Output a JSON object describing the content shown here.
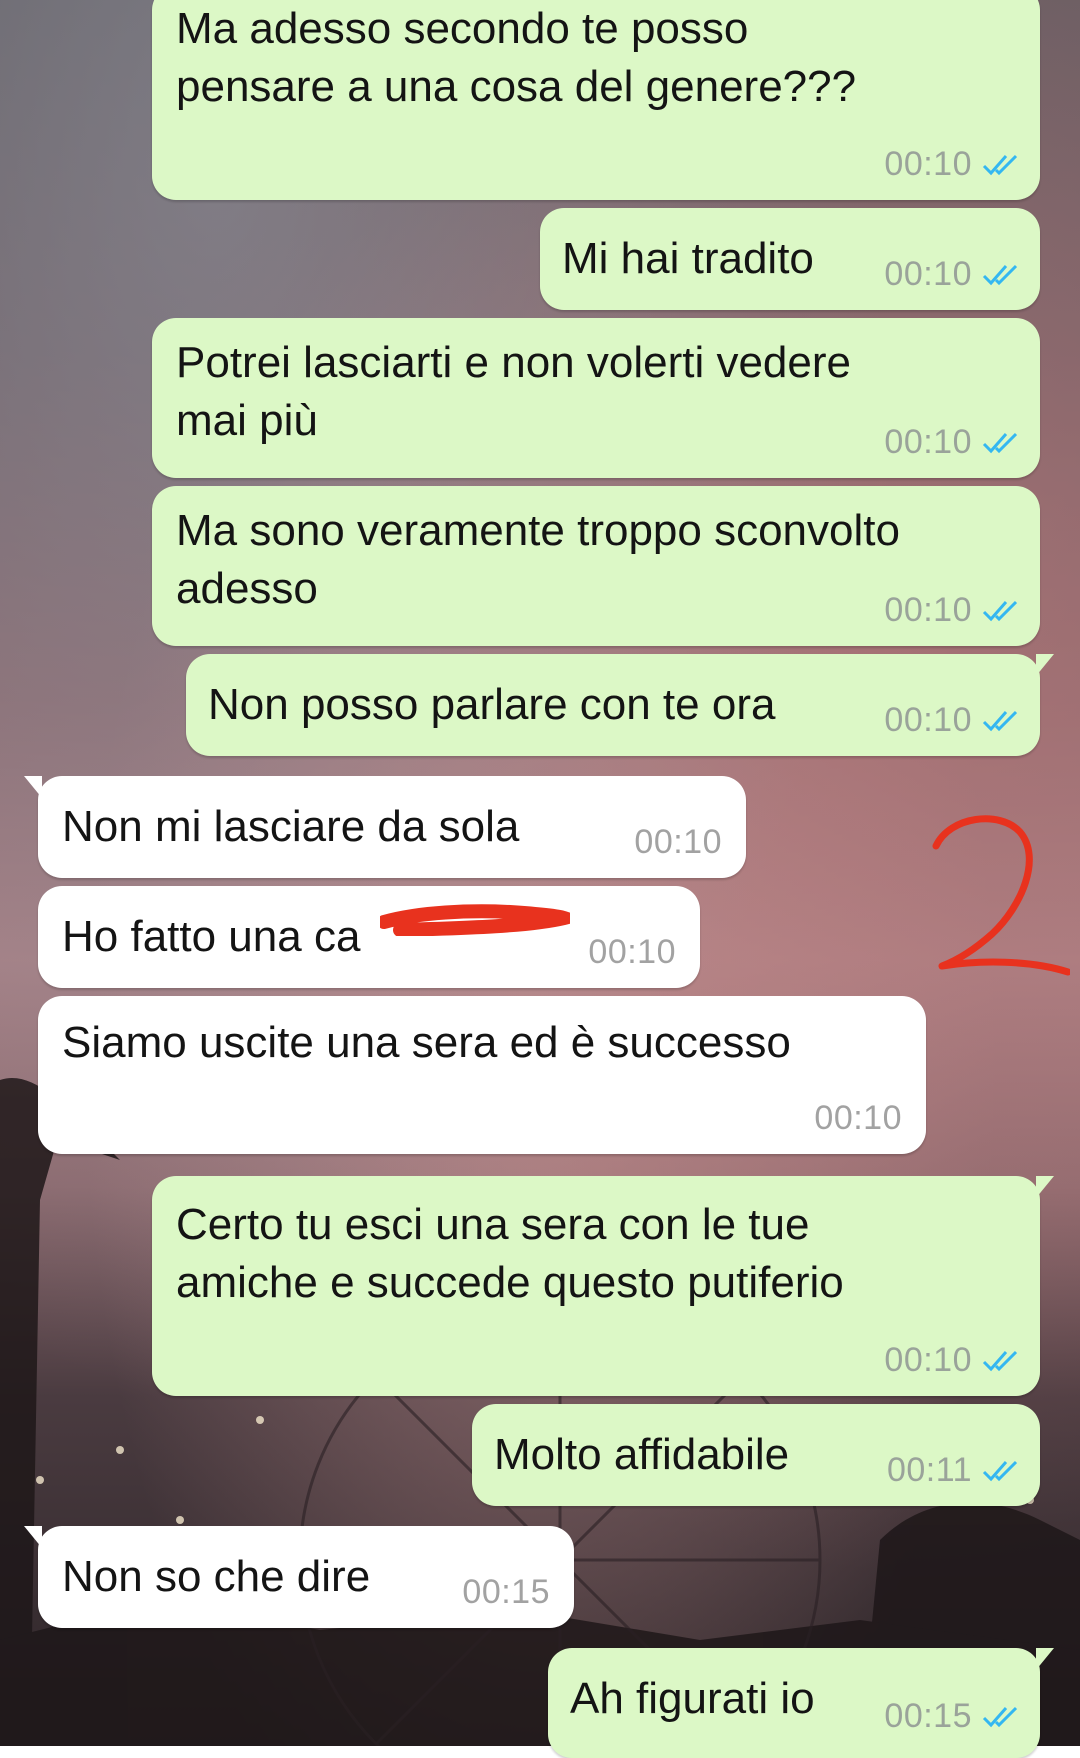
{
  "colors": {
    "outgoing_bubble": "#dcf8c6",
    "incoming_bubble": "#ffffff",
    "read_ticks": "#34b7f1",
    "annotation_red": "#e8321e"
  },
  "messages": [
    {
      "direction": "outgoing",
      "text": "Ma adesso secondo te posso\npensare a una cosa del genere???",
      "time": "00:10",
      "status_icon": "double-check-read-icon"
    },
    {
      "direction": "outgoing",
      "text": "Mi hai tradito",
      "time": "00:10",
      "status_icon": "double-check-read-icon"
    },
    {
      "direction": "outgoing",
      "text": "Potrei lasciarti e non volerti vedere\nmai più",
      "time": "00:10",
      "status_icon": "double-check-read-icon"
    },
    {
      "direction": "outgoing",
      "text": "Ma sono veramente troppo sconvolto\nadesso",
      "time": "00:10",
      "status_icon": "double-check-read-icon"
    },
    {
      "direction": "outgoing",
      "text": "Non posso parlare con te ora",
      "time": "00:10",
      "status_icon": "double-check-read-icon"
    },
    {
      "direction": "incoming",
      "text": "Non mi lasciare da sola",
      "time": "00:10"
    },
    {
      "direction": "incoming",
      "text": "Ho fatto una ca",
      "time": "00:10",
      "redaction": "red-scribble"
    },
    {
      "direction": "incoming",
      "text": "Siamo uscite una sera ed è successo",
      "time": "00:10"
    },
    {
      "direction": "outgoing",
      "text": "Certo tu esci una sera con le tue\namiche e succede questo putiferio",
      "time": "00:10",
      "status_icon": "double-check-read-icon"
    },
    {
      "direction": "outgoing",
      "text": "Molto affidabile",
      "time": "00:11",
      "status_icon": "double-check-read-icon"
    },
    {
      "direction": "incoming",
      "text": "Non so che dire",
      "time": "00:15"
    },
    {
      "direction": "outgoing",
      "text": "Ah figurati io",
      "time": "00:15",
      "status_icon": "double-check-read-icon"
    }
  ],
  "annotation": {
    "text": "2",
    "icon": "handwritten-number-annotation"
  }
}
